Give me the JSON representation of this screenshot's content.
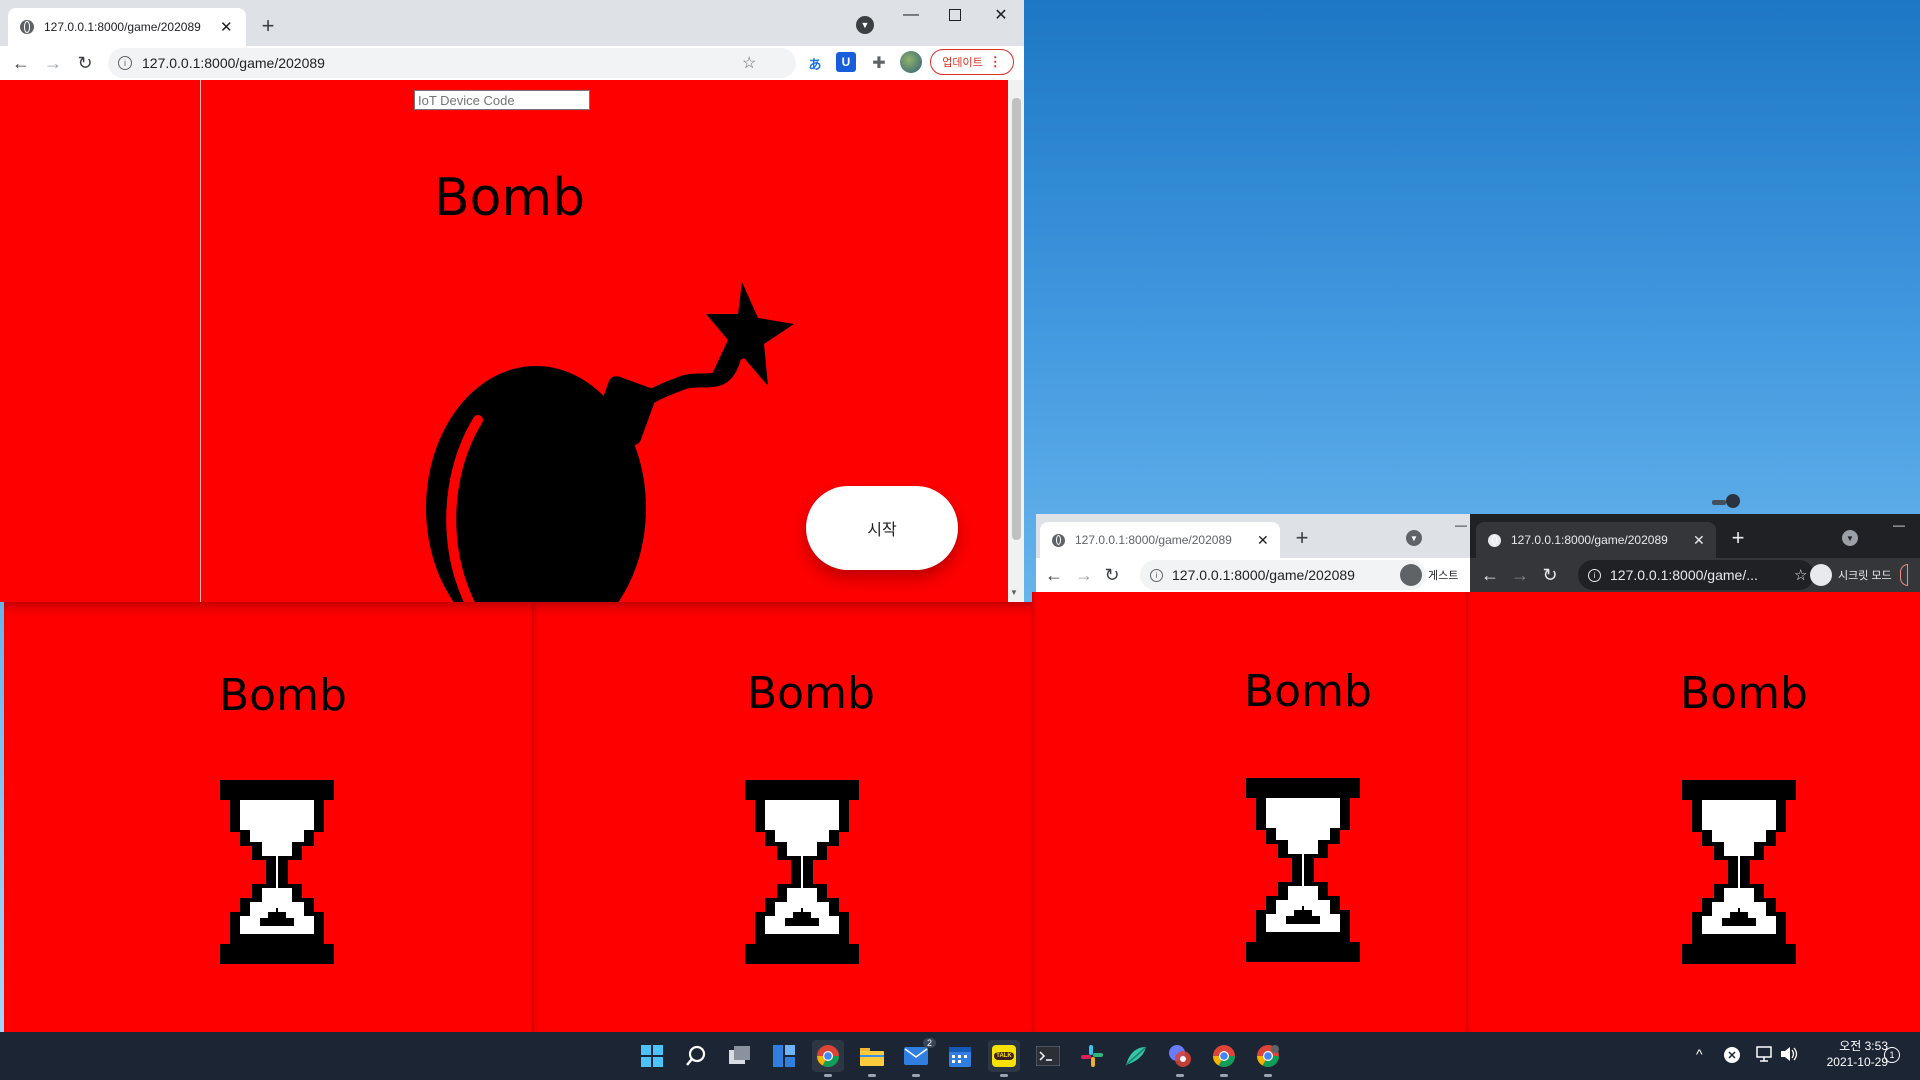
{
  "desktop": {
    "wallpaper": "sky-beach"
  },
  "main_window": {
    "tab_title": "127.0.0.1:8000/game/202089",
    "url": "127.0.0.1:8000/game/202089",
    "update_button": "업데이트",
    "page": {
      "device_code_placeholder": "IoT Device Code",
      "title": "Bomb",
      "start_button": "시작",
      "bg_color": "#ff0000"
    }
  },
  "guest_window": {
    "tab_title": "127.0.0.1:8000/game/202089",
    "url": "127.0.0.1:8000/game/202089",
    "profile_label": "게스트"
  },
  "incognito_window": {
    "tab_title": "127.0.0.1:8000/game/202089",
    "url": "127.0.0.1:8000/game/...",
    "profile_label": "시크릿 모드"
  },
  "panels": [
    {
      "title": "Bomb",
      "icon": "hourglass-icon"
    },
    {
      "title": "Bomb",
      "icon": "hourglass-icon"
    },
    {
      "title": "Bomb",
      "icon": "hourglass-icon"
    },
    {
      "title": "Bomb",
      "icon": "hourglass-icon"
    }
  ],
  "taskbar": {
    "clock_time": "오전 3:53",
    "clock_date": "2021-10-29",
    "notification_count": "1",
    "mail_badge": "2",
    "kakao_label": "TALK",
    "icons": [
      "windows-start-icon",
      "search-icon",
      "task-view-icon",
      "widgets-icon",
      "chrome-icon",
      "file-explorer-icon",
      "mail-icon",
      "calendar-icon",
      "kakaotalk-icon",
      "terminal-icon",
      "slack-icon",
      "app-icon",
      "app-icon",
      "chrome-icon",
      "chrome-icon"
    ]
  },
  "colors": {
    "accent_red": "#ff0000",
    "taskbar": "#1c2533",
    "chrome_light": "#dee1e6",
    "chrome_dark": "#35363a"
  }
}
